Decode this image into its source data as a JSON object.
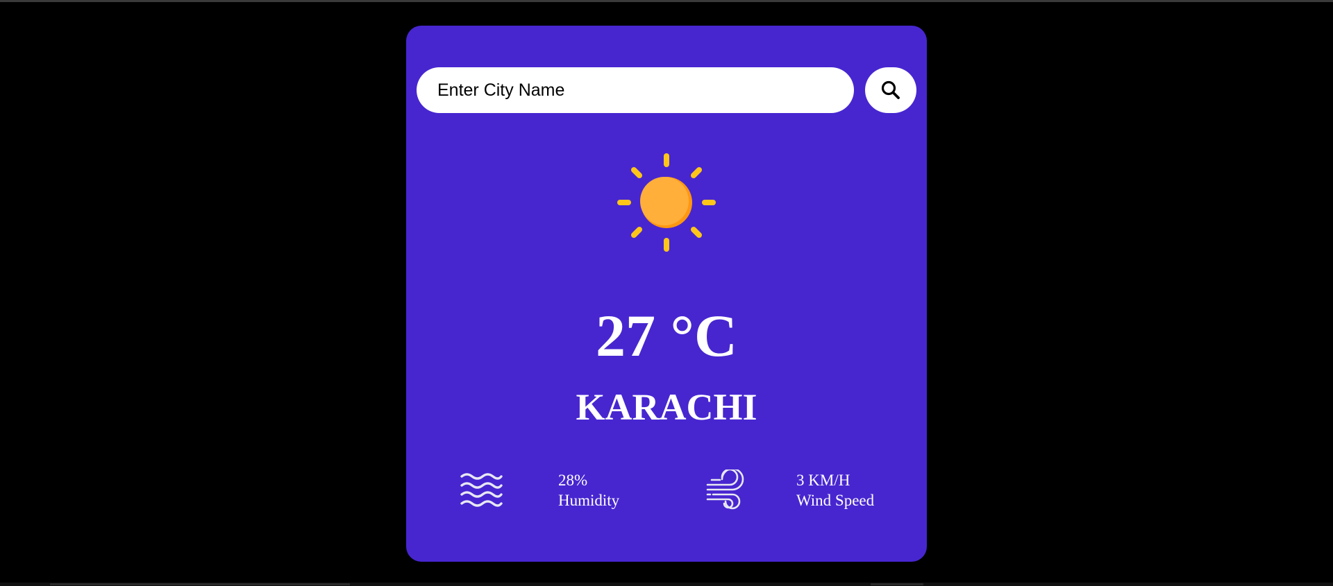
{
  "search": {
    "placeholder": "Enter City Name",
    "button_icon": "search-icon"
  },
  "weather": {
    "condition_icon": "sun-icon",
    "temperature": "27",
    "unit": "°C",
    "city": "KARACHI"
  },
  "stats": {
    "humidity": {
      "icon": "waves-icon",
      "value": "28%",
      "label": "Humidity"
    },
    "wind": {
      "icon": "wind-icon",
      "value": "3 KM/H",
      "label": "Wind Speed"
    }
  },
  "colors": {
    "page_background": "#000000",
    "card_background": "#4726d0",
    "sun_rays": "#ffc619",
    "sun_body": "#ffa62e",
    "text": "#ffffff"
  }
}
